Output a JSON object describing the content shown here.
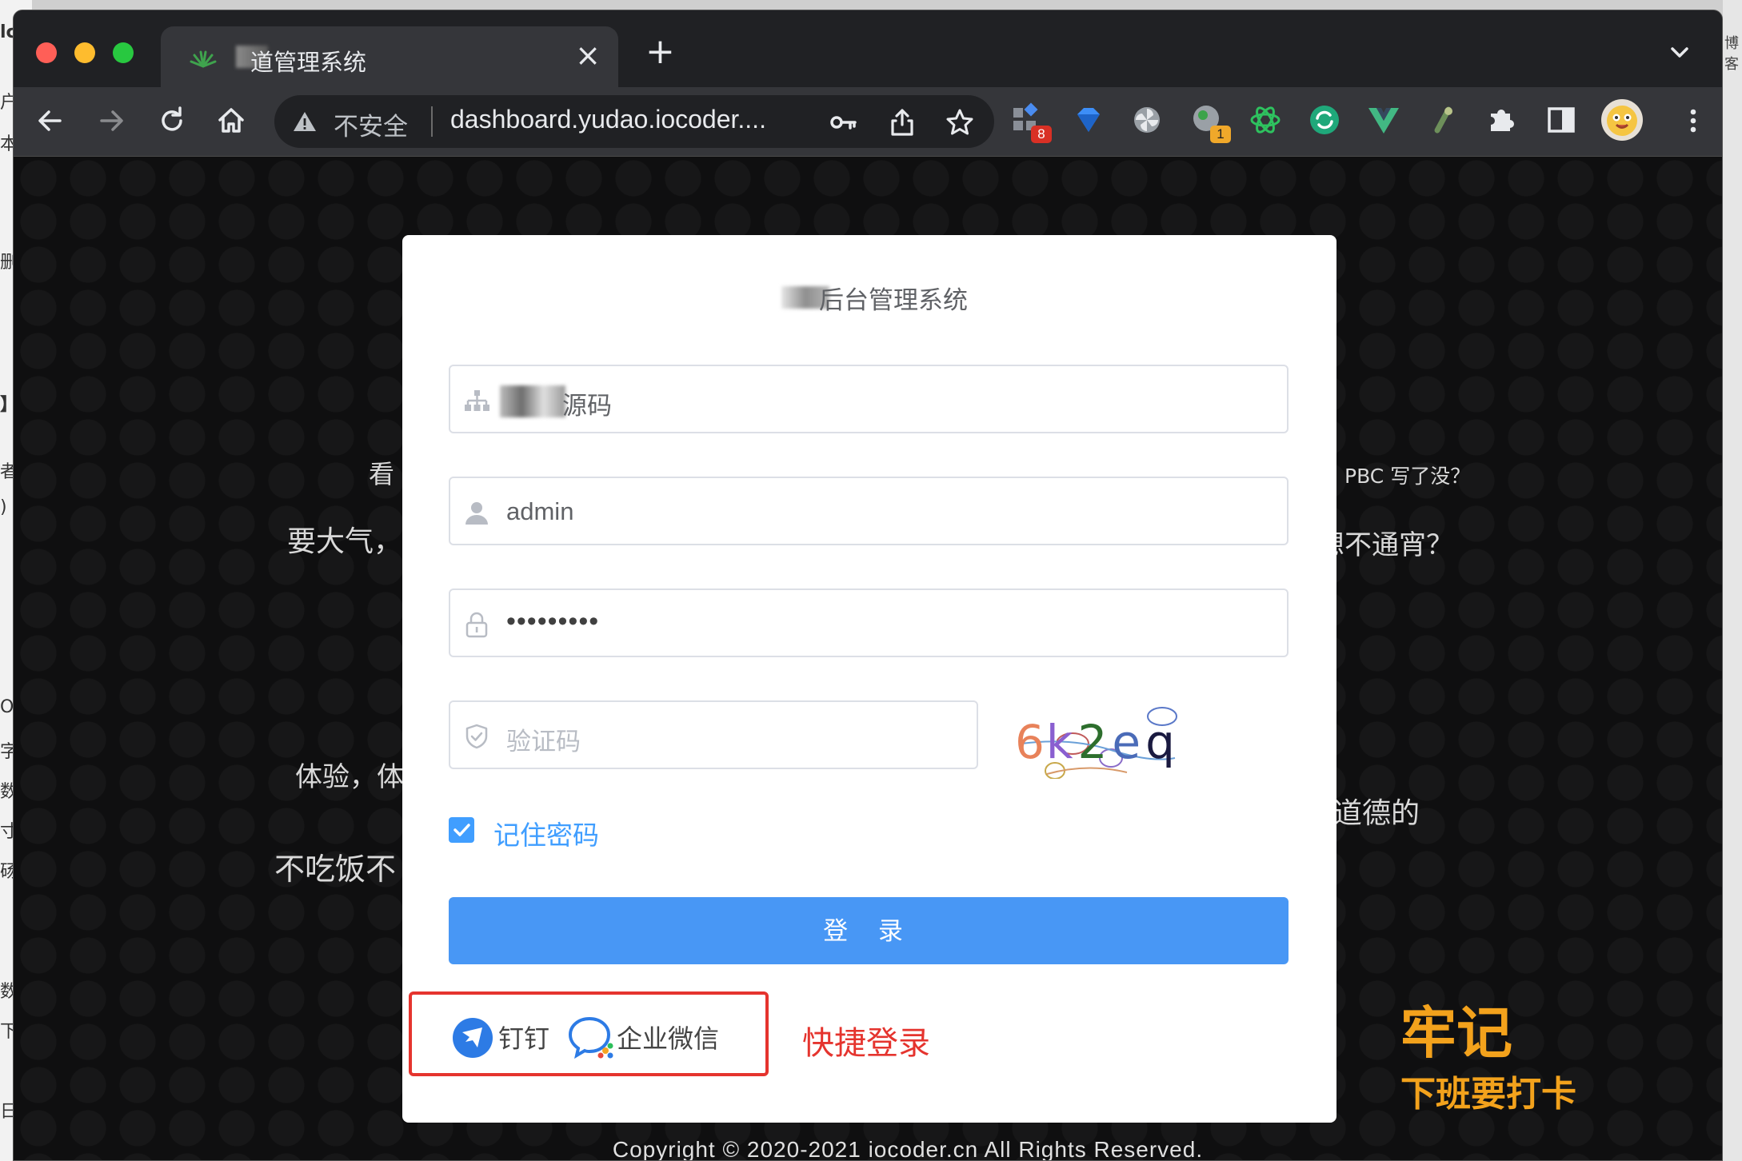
{
  "background_window": {
    "chars": [
      "lc",
      "户",
      "本",
      "删",
      "】",
      "者",
      ")",
      "O",
      "字",
      "数",
      "寸",
      "砀",
      "数",
      "下",
      "日"
    ],
    "right_chars": "博客"
  },
  "browser": {
    "tab_title": "道管理系统",
    "tab_close": "×",
    "new_tab": "+",
    "security_label": "不安全",
    "url": "dashboard.yudao.iocoder....",
    "extension_badges": {
      "ext1": "8",
      "ext4": "1"
    }
  },
  "background_text": {
    "t1": "看",
    "t2": "要大气，",
    "t3": "体验，体",
    "t4": "不吃饭不",
    "t5": "PBC 写了没？",
    "t6": "想不通宵？",
    "t7": "道德的"
  },
  "login": {
    "title": "后台管理系统",
    "tenant_value": "源码",
    "username_value": "admin",
    "password_value": "•••••••••",
    "captcha_placeholder": "验证码",
    "captcha_text": "6k2eq",
    "remember_label": "记住密码",
    "login_button": "登 录",
    "social": {
      "dingtalk_label": "钉钉",
      "wecom_label": "企业微信"
    }
  },
  "annotations": {
    "quick_login": "快捷登录",
    "remember_title": "牢记",
    "remember_sub": "下班要打卡"
  },
  "footer": {
    "copyright": "Copyright © 2020-2021 iocoder.cn All Rights Reserved."
  },
  "colors": {
    "primary": "#409eff",
    "button": "#4897f5",
    "annotation_red": "#e5342e",
    "annotation_orange": "#f3a21c",
    "chrome_dark": "#202124"
  }
}
